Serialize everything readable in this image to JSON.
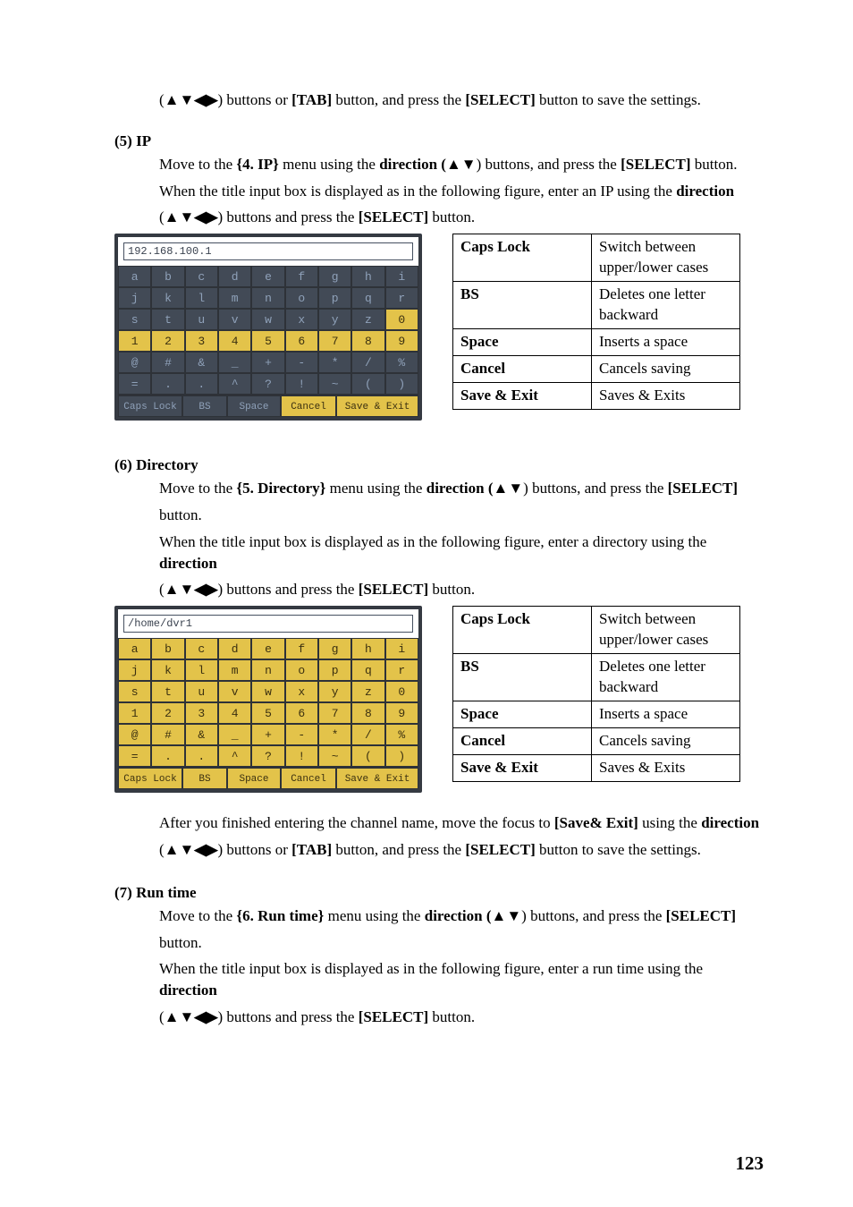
{
  "top_line": {
    "pre": " (",
    "arrows": "▲▼◀▶",
    "mid1": ") buttons or ",
    "tab": "[TAB]",
    "mid2": " button, and press the ",
    "select": "[SELECT]",
    "tail": " button to save the settings."
  },
  "s5": {
    "heading": "(5) IP",
    "l1": {
      "pre": "Move to the ",
      "menu": "{4. IP}",
      "mid": " menu using the ",
      "dir": "direction (",
      "arrows": "▲▼",
      "mid2": ") buttons, and press the ",
      "select": "[SELECT]",
      "tail": " button."
    },
    "l2": {
      "a": "When the title input box is displayed as in the following figure, enter an IP using the ",
      "dir": "direction"
    },
    "l3": {
      "pre": " (",
      "arrows": "▲▼◀▶",
      "mid": ") buttons and press the ",
      "select": "[SELECT]",
      "tail": " button."
    },
    "input": "192.168.100.1"
  },
  "kbd": {
    "rows": [
      [
        "a",
        "b",
        "c",
        "d",
        "e",
        "f",
        "g",
        "h",
        "i"
      ],
      [
        "j",
        "k",
        "l",
        "m",
        "n",
        "o",
        "p",
        "q",
        "r"
      ],
      [
        "s",
        "t",
        "u",
        "v",
        "w",
        "x",
        "y",
        "z",
        "0"
      ],
      [
        "1",
        "2",
        "3",
        "4",
        "5",
        "6",
        "7",
        "8",
        "9"
      ],
      [
        "@",
        "#",
        "&",
        "_",
        "+",
        "-",
        "*",
        "/",
        "%"
      ],
      [
        "=",
        " .",
        "  .",
        "^",
        "?",
        "!",
        "~",
        "(",
        ")"
      ]
    ],
    "fn": {
      "caps": "Caps Lock",
      "bs": "BS",
      "space": "Space",
      "cancel": "Cancel",
      "se": "Save & Exit"
    }
  },
  "legend": [
    {
      "k": "Caps Lock",
      "v": "Switch between upper/lower cases"
    },
    {
      "k": "BS",
      "v": "Deletes one letter backward"
    },
    {
      "k": "Space",
      "v": "Inserts a space"
    },
    {
      "k": "Cancel",
      "v": "Cancels saving"
    },
    {
      "k": "Save & Exit",
      "v": "Saves & Exits"
    }
  ],
  "s6": {
    "heading": "(6) Directory",
    "l1": {
      "pre": "Move to the ",
      "menu": "{5. Directory}",
      "mid": " menu using the ",
      "dir": "direction (",
      "arrows": "▲▼",
      "mid2": ") buttons, and press the ",
      "select": "[SELECT]"
    },
    "l1b": " button.",
    "l2": {
      "a": "When the title input box is displayed as in the following figure, enter a directory using the ",
      "dir": "direction"
    },
    "l3": {
      "pre": " (",
      "arrows": "▲▼◀▶",
      "mid": ") buttons and press the ",
      "select": "[SELECT]",
      "tail": " button."
    },
    "input": "/home/dvr1",
    "after1": {
      "a": "After you finished entering the channel name, move the focus to ",
      "se": "[Save& Exit]",
      "mid": " using the ",
      "dir": "direction"
    },
    "after2": {
      "pre": " (",
      "arrows": "▲▼◀▶",
      "mid1": ") buttons or ",
      "tab": "[TAB]",
      "mid2": " button, and press the ",
      "select": "[SELECT]",
      "tail": " button to save the settings."
    }
  },
  "s7": {
    "heading": "(7) Run time",
    "l1": {
      "pre": "Move to the ",
      "menu": "{6. Run time}",
      "mid": " menu using the ",
      "dir": "direction (",
      "arrows": "▲▼",
      "mid2": ") buttons, and press the ",
      "select": "[SELECT]"
    },
    "l1b": " button.",
    "l2": {
      "a": "When the title input box is displayed as in the following figure, enter a run time using the ",
      "dir": "direction"
    },
    "l3": {
      "pre": " (",
      "arrows": "▲▼◀▶",
      "mid": ") buttons and press the ",
      "select": "[SELECT]",
      "tail": " button."
    }
  },
  "page_number": "123"
}
